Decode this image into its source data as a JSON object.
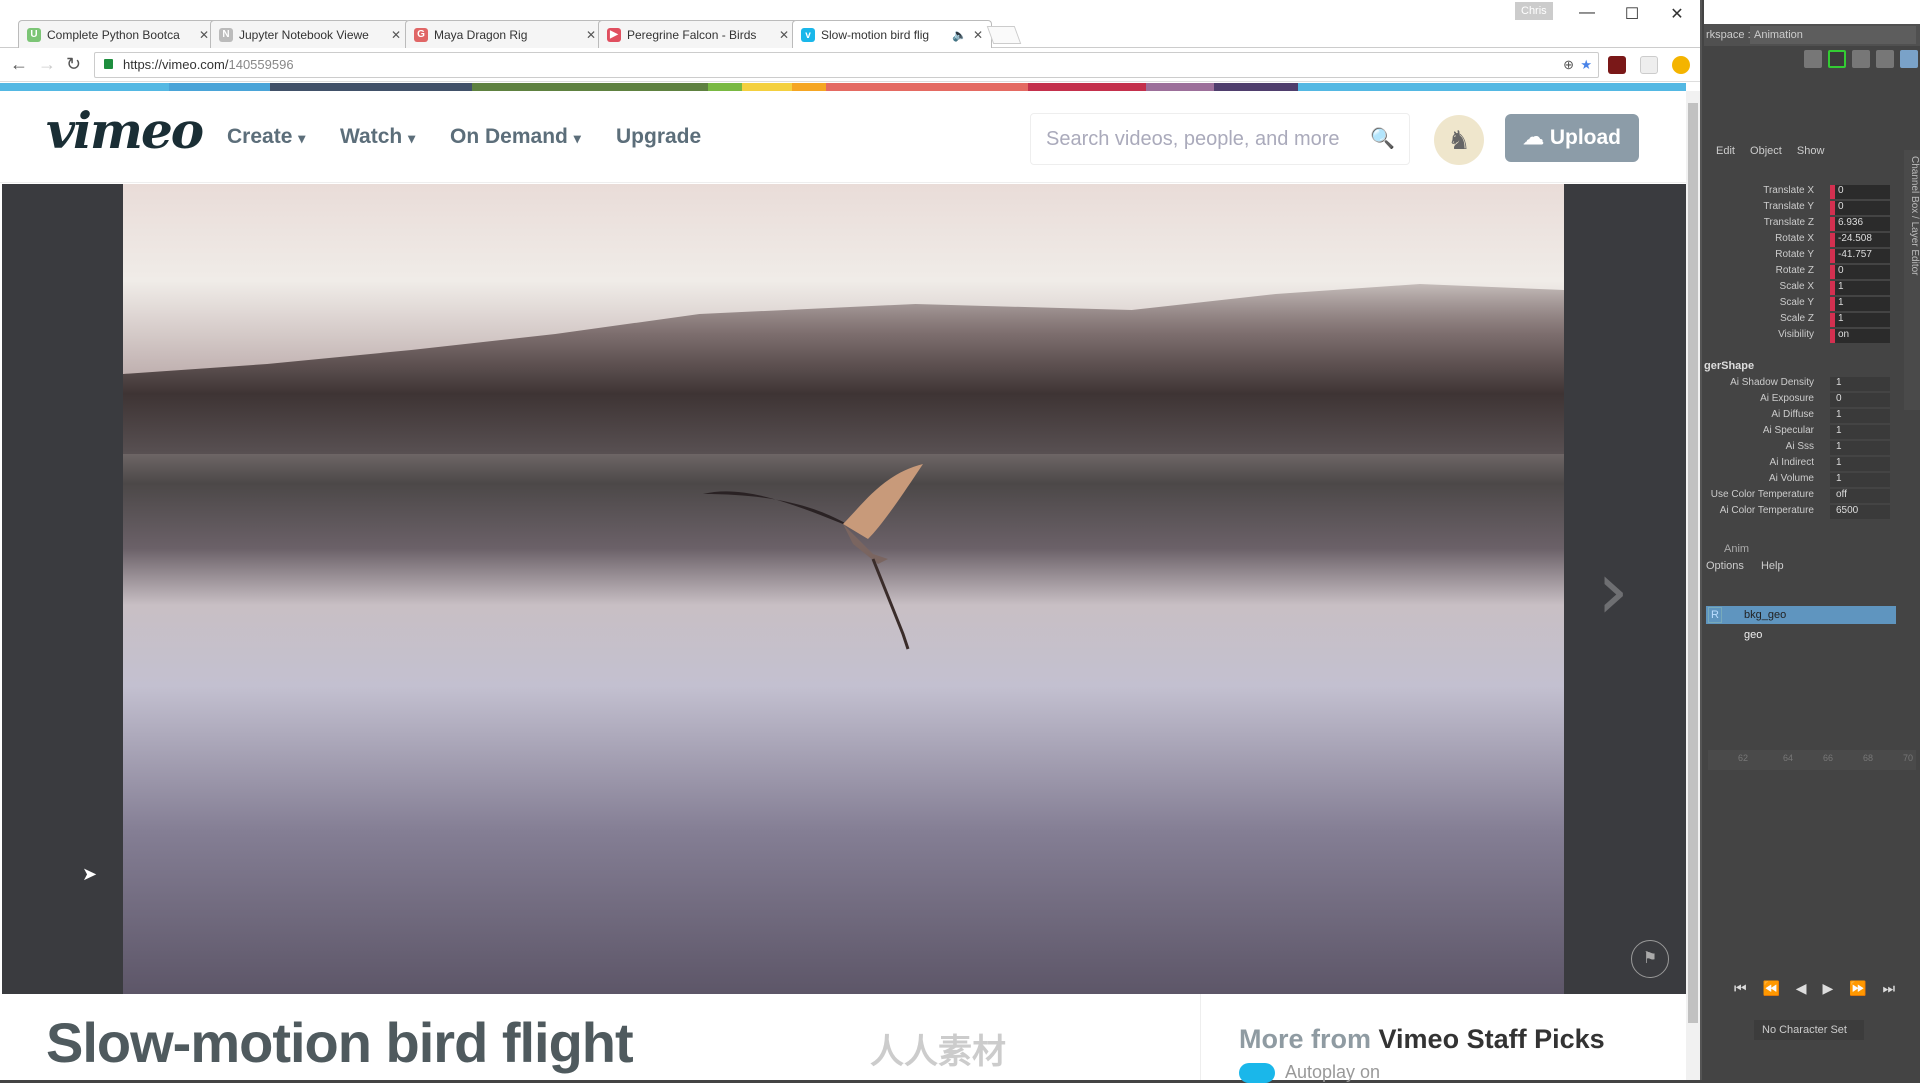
{
  "browser": {
    "tabs": [
      {
        "label": "Complete Python Bootca",
        "favicon": "udemy-icon",
        "color": "#7cc576",
        "glyph": "U"
      },
      {
        "label": "Jupyter Notebook Viewe",
        "favicon": "notebook-icon",
        "color": "#bbbbbb",
        "glyph": "N"
      },
      {
        "label": "Maya Dragon Rig",
        "favicon": "gumroad-icon",
        "color": "#e06666",
        "glyph": "G"
      },
      {
        "label": "Peregrine Falcon - Birds",
        "favicon": "youtube-icon",
        "color": "#e04f5f",
        "glyph": "▶"
      },
      {
        "label": "Slow-motion bird flig",
        "favicon": "vimeo-icon",
        "color": "#1ab7ea",
        "glyph": "v",
        "active": true,
        "audio": "🔈"
      }
    ],
    "user": "Chris",
    "url_host": "https://vimeo.com/",
    "url_path": "140559596",
    "window_controls": {
      "minimize": "—",
      "maximize": "☐",
      "close": "✕"
    }
  },
  "vimeo": {
    "logo": "vimeo",
    "nav": [
      {
        "label": "Create",
        "dropdown": true
      },
      {
        "label": "Watch",
        "dropdown": true
      },
      {
        "label": "On Demand",
        "dropdown": true
      },
      {
        "label": "Upgrade",
        "dropdown": false
      }
    ],
    "dropdown_glyph": "⌄",
    "search_placeholder": "Search videos, people, and more",
    "upload_label": "Upload",
    "stripe_colors": [
      "#54b8e3",
      "#4aa4d8",
      "#415169",
      "#5e8140",
      "#79b942",
      "#f4d03f",
      "#f5a623",
      "#e46a62",
      "#c4304c",
      "#9c6f9a",
      "#4f3e6d",
      "#54b8e3"
    ],
    "video_title": "Slow-motion bird flight",
    "more_from_prefix": "More from",
    "more_from_channel": "Vimeo Staff Picks",
    "autoplay_label": "Autoplay on",
    "watermark": "人人素材"
  },
  "maya": {
    "workspace_label": "rkspace :",
    "workspace_value": "Animation",
    "channel_menu": [
      "Edit",
      "Object",
      "Show"
    ],
    "channel_side_tab": "Channel Box / Layer Editor",
    "transform_attrs": [
      {
        "name": "Translate X",
        "value": "0"
      },
      {
        "name": "Translate Y",
        "value": "0"
      },
      {
        "name": "Translate Z",
        "value": "6.936"
      },
      {
        "name": "Rotate X",
        "value": "-24.508"
      },
      {
        "name": "Rotate Y",
        "value": "-41.757"
      },
      {
        "name": "Rotate Z",
        "value": "0"
      },
      {
        "name": "Scale X",
        "value": "1"
      },
      {
        "name": "Scale Y",
        "value": "1"
      },
      {
        "name": "Scale Z",
        "value": "1"
      },
      {
        "name": "Visibility",
        "value": "on"
      }
    ],
    "shape_header": "gerShape",
    "shape_attrs": [
      {
        "name": "Ai Shadow Density",
        "value": "1"
      },
      {
        "name": "Ai Exposure",
        "value": "0"
      },
      {
        "name": "Ai Diffuse",
        "value": "1"
      },
      {
        "name": "Ai Specular",
        "value": "1"
      },
      {
        "name": "Ai Sss",
        "value": "1"
      },
      {
        "name": "Ai Indirect",
        "value": "1"
      },
      {
        "name": "Ai Volume",
        "value": "1"
      },
      {
        "name": "Use Color Temperature",
        "value": "off"
      },
      {
        "name": "Ai Color Temperature",
        "value": "6500"
      }
    ],
    "layer_tab": "Anim",
    "layer_menu": [
      "Options",
      "Help"
    ],
    "layers": [
      {
        "name": "bkg_geo",
        "flag": "R",
        "selected": true
      },
      {
        "name": "geo",
        "flag": "",
        "selected": false
      }
    ],
    "timeline_ticks": [
      "62",
      "64",
      "66",
      "68",
      "70"
    ],
    "playback_controls": "⏮ ⏪ ◀ ▶ ⏩ ⏭",
    "character_set": "No Character Set"
  }
}
